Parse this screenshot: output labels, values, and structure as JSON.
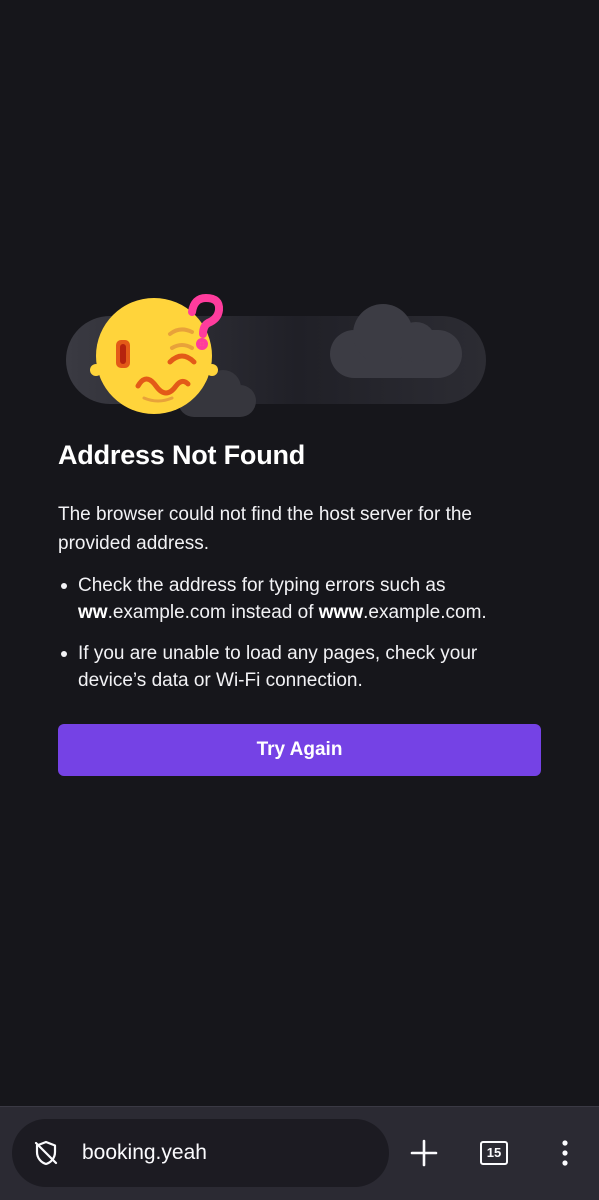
{
  "error": {
    "title": "Address Not Found",
    "description": "The browser could not find the host server for the provided address.",
    "tips": [
      {
        "prefix": "Check the address for typing errors such as ",
        "bad": "ww",
        "middle": ".example.com instead of ",
        "good": "www",
        "suffix": ".example.com."
      },
      {
        "text": "If you are unable to load any pages, check your device’s data or Wi-Fi connection."
      }
    ],
    "button_label": "Try Again"
  },
  "toolbar": {
    "url": "booking.yeah",
    "tab_count": "15",
    "icons": {
      "tracking": "shield-slash-icon",
      "new_tab": "plus-icon",
      "tabs": "tab-counter-icon",
      "menu": "kebab-menu-icon"
    }
  },
  "colors": {
    "background": "#16161b",
    "button": "#7542e5",
    "toolbar": "#2b2a33",
    "url_bar": "#1c1b22",
    "question_mark": "#ff3c9d",
    "face": "#ffd43b"
  }
}
